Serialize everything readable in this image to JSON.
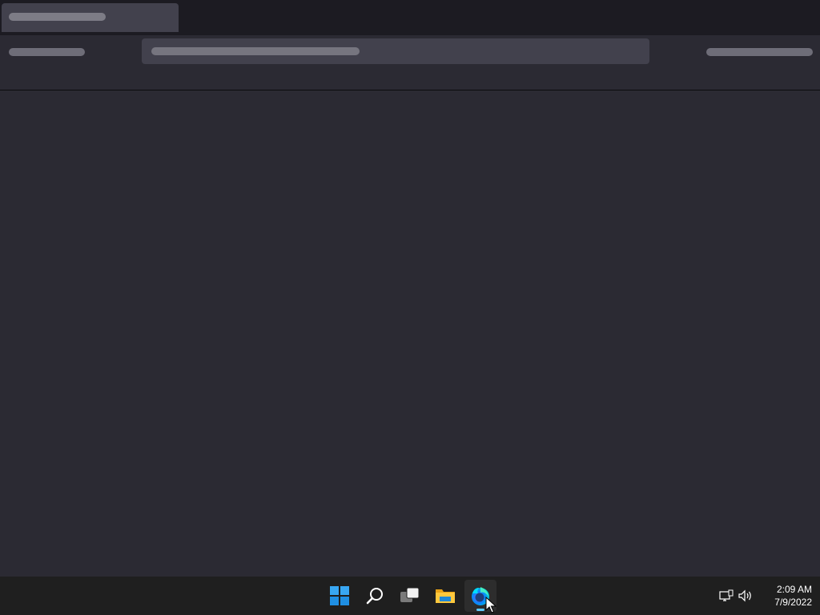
{
  "browser": {
    "tab": {
      "title": ""
    },
    "toolbar": {
      "address": ""
    }
  },
  "taskbar": {
    "apps": [
      {
        "name": "Start",
        "icon": "windows-start-icon"
      },
      {
        "name": "Search",
        "icon": "search-icon"
      },
      {
        "name": "Task View",
        "icon": "task-view-icon"
      },
      {
        "name": "File Explorer",
        "icon": "folder-icon"
      },
      {
        "name": "Firefox Developer Edition",
        "icon": "firefox-icon",
        "active": true
      }
    ],
    "tray": {
      "icons": [
        "network-icon",
        "volume-icon"
      ],
      "time": "2:09 AM",
      "date": "7/9/2022"
    }
  },
  "colors": {
    "accent": "#60cdff",
    "taskbar": "#1f1f1f",
    "browser_chrome": "#1c1b22",
    "content": "#2b2a33"
  }
}
